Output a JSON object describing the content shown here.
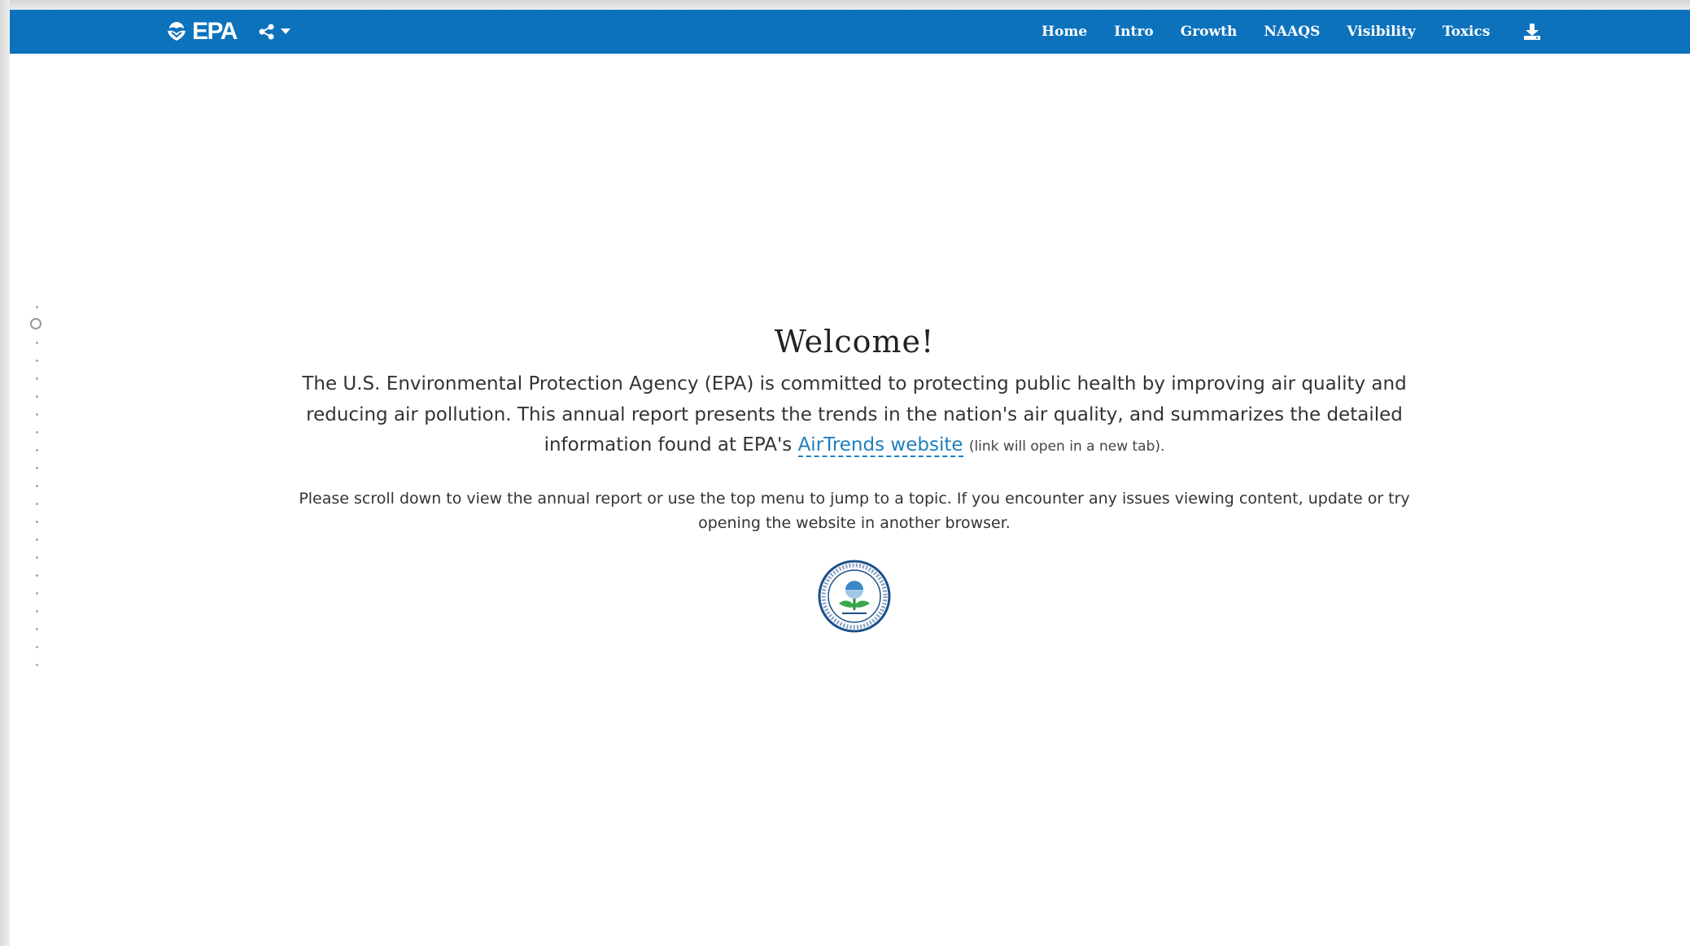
{
  "header": {
    "logo_text": "EPA",
    "share_icon": "share-icon",
    "nav": [
      "Home",
      "Intro",
      "Growth",
      "NAAQS",
      "Visibility",
      "Toxics"
    ],
    "download_icon": "download-icon",
    "bar_color": "#0c72bc"
  },
  "main": {
    "title": "Welcome!",
    "lead_text": "The U.S. Environmental Protection Agency (EPA) is committed to protecting public health by improving air quality and reducing air pollution. This annual report presents the trends in the nation's air quality, and summarizes the detailed information found at EPA's",
    "link_text": "AirTrends website",
    "link_note": "(link will open in a new tab).",
    "instructions": "Please scroll down to view the annual report or use the top menu to jump to a topic. If you encounter any issues viewing content, update or try opening the website in another browser.",
    "seal_icon": "epa-seal-icon",
    "link_color": "#1f7fbf"
  }
}
